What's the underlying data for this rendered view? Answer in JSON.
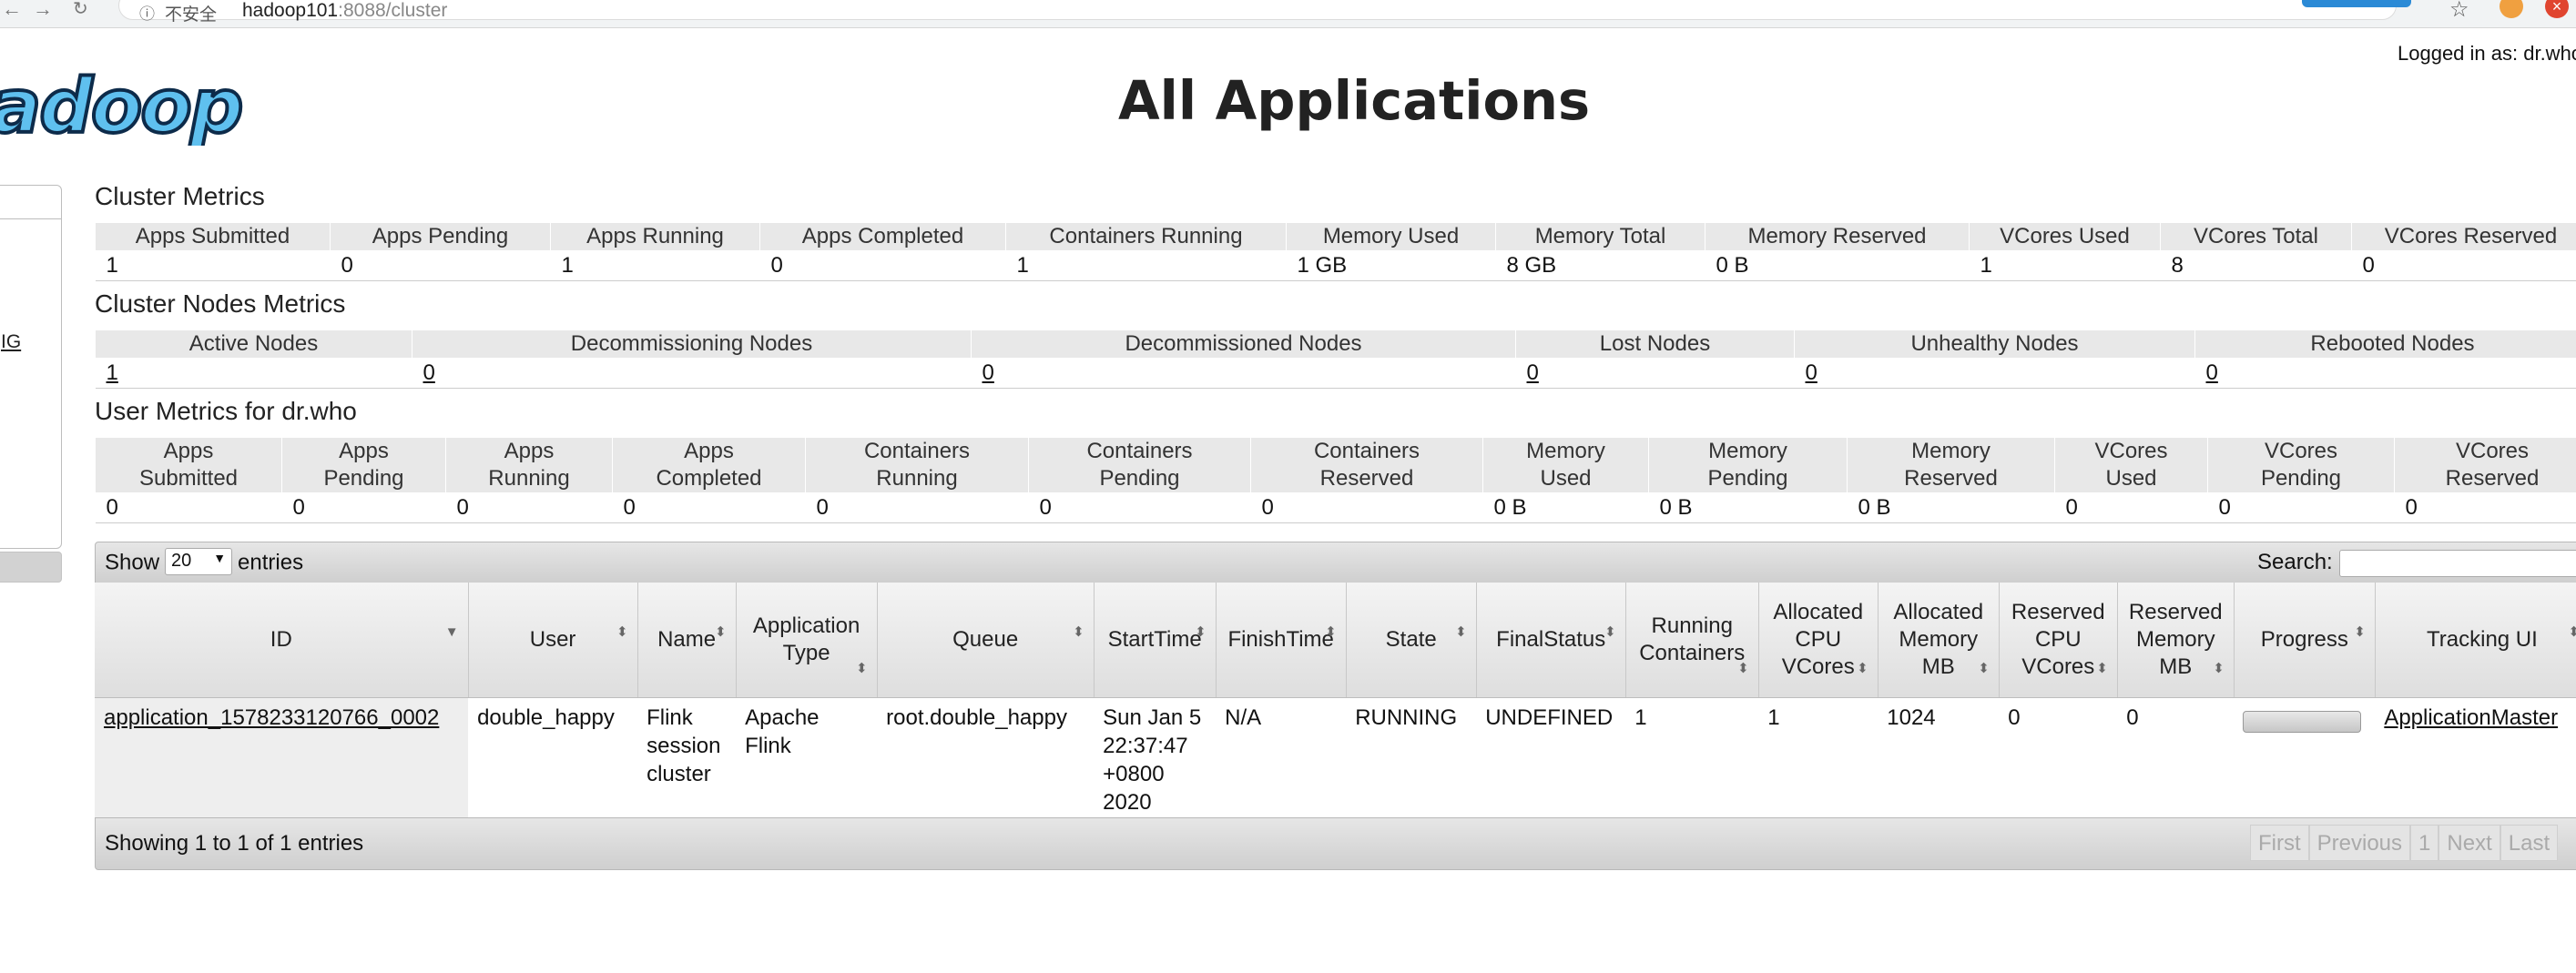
{
  "browser": {
    "security_label": "不安全",
    "url_host": "hadoop101",
    "url_rest": ":8088/cluster"
  },
  "header": {
    "logo_text": "adoop",
    "title": "All Applications",
    "logged_in": "Logged in as: dr.who"
  },
  "nav": {
    "link_fragment": "IG"
  },
  "cluster_metrics": {
    "title": "Cluster Metrics",
    "headers": [
      "Apps Submitted",
      "Apps Pending",
      "Apps Running",
      "Apps Completed",
      "Containers Running",
      "Memory Used",
      "Memory Total",
      "Memory Reserved",
      "VCores Used",
      "VCores Total",
      "VCores Reserved"
    ],
    "values": [
      "1",
      "0",
      "1",
      "0",
      "1",
      "1 GB",
      "8 GB",
      "0 B",
      "1",
      "8",
      "0"
    ]
  },
  "node_metrics": {
    "title": "Cluster Nodes Metrics",
    "headers": [
      "Active Nodes",
      "Decommissioning Nodes",
      "Decommissioned Nodes",
      "Lost Nodes",
      "Unhealthy Nodes",
      "Rebooted Nodes"
    ],
    "values": [
      "1",
      "0",
      "0",
      "0",
      "0",
      "0"
    ]
  },
  "user_metrics": {
    "title": "User Metrics for dr.who",
    "headers": [
      [
        "Apps",
        "Submitted"
      ],
      [
        "Apps",
        "Pending"
      ],
      [
        "Apps",
        "Running"
      ],
      [
        "Apps",
        "Completed"
      ],
      [
        "Containers",
        "Running"
      ],
      [
        "Containers",
        "Pending"
      ],
      [
        "Containers",
        "Reserved"
      ],
      [
        "Memory",
        "Used"
      ],
      [
        "Memory",
        "Pending"
      ],
      [
        "Memory",
        "Reserved"
      ],
      [
        "VCores",
        "Used"
      ],
      [
        "VCores",
        "Pending"
      ],
      [
        "VCores",
        "Reserved"
      ]
    ],
    "values": [
      "0",
      "0",
      "0",
      "0",
      "0",
      "0",
      "0",
      "0 B",
      "0 B",
      "0 B",
      "0",
      "0",
      "0"
    ]
  },
  "apps_table": {
    "show_label": "Show",
    "entries_label": "entries",
    "page_size": "20",
    "search_label": "Search:",
    "columns": [
      [
        "ID"
      ],
      [
        "User"
      ],
      [
        "Name"
      ],
      [
        "Application",
        "Type"
      ],
      [
        "Queue"
      ],
      [
        "StartTime"
      ],
      [
        "FinishTime"
      ],
      [
        "State"
      ],
      [
        "FinalStatus"
      ],
      [
        "Running",
        "Containers"
      ],
      [
        "Allocated",
        "CPU",
        "VCores"
      ],
      [
        "Allocated",
        "Memory",
        "MB"
      ],
      [
        "Reserved",
        "CPU",
        "VCores"
      ],
      [
        "Reserved",
        "Memory",
        "MB"
      ],
      [
        "Progress"
      ],
      [
        "Tracking UI"
      ]
    ],
    "rows": [
      {
        "id": "application_1578233120766_0002",
        "user": "double_happy",
        "name": [
          "Flink",
          "session",
          "cluster"
        ],
        "type": [
          "Apache",
          "Flink"
        ],
        "queue": "root.double_happy",
        "start": [
          "Sun Jan 5",
          "22:37:47",
          "+0800",
          "2020"
        ],
        "finish": "N/A",
        "state": "RUNNING",
        "final_status": "UNDEFINED",
        "running_containers": "1",
        "alloc_vcores": "1",
        "alloc_mem": "1024",
        "res_vcores": "0",
        "res_mem": "0",
        "progress": 0,
        "tracking": "ApplicationMaster"
      }
    ],
    "info": "Showing 1 to 1 of 1 entries",
    "pager": [
      "First",
      "Previous",
      "1",
      "Next",
      "Last"
    ]
  }
}
